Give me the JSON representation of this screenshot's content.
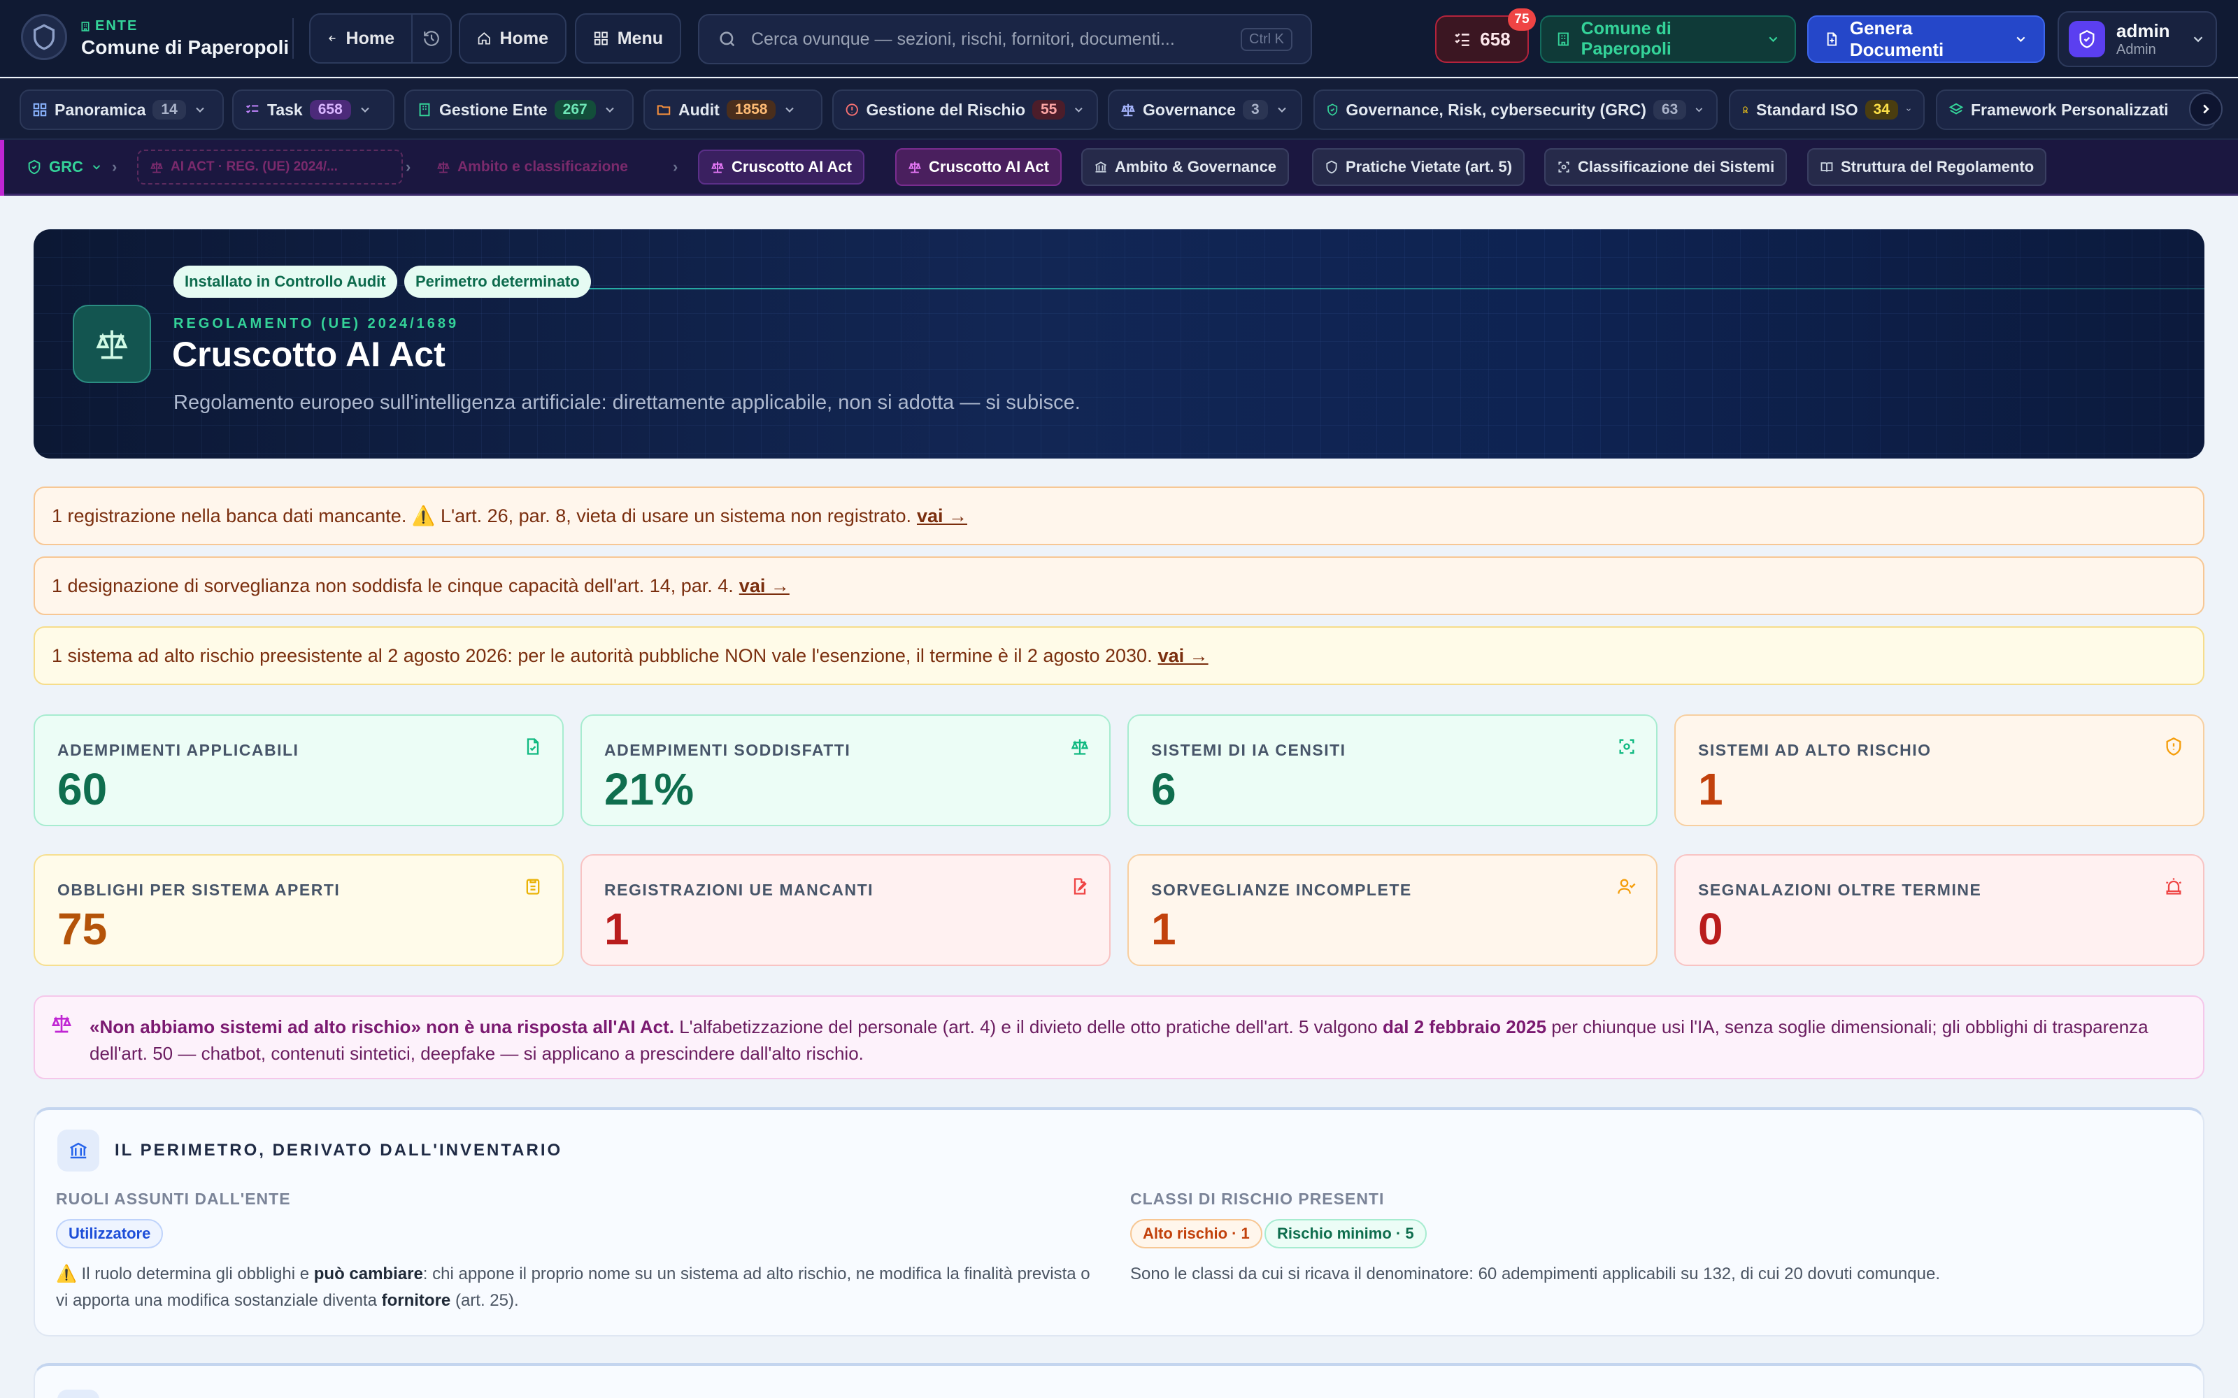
{
  "colors": {
    "accent": "#34d399",
    "brand_blue": "#2547c9",
    "danger": "#ef4444",
    "purple": "#c026d3"
  },
  "header": {
    "ente_label": "ENTE",
    "ente_name": "Comune di Paperopoli",
    "back_home_label": "Home",
    "home_label": "Home",
    "menu_label": "Menu",
    "search_placeholder": "Cerca ovunque — sezioni, rischi, fornitori, documenti...",
    "search_shortcut": "Ctrl K",
    "tasks_count": "658",
    "tasks_badge": "75",
    "ente_selector": "Comune di Paperopoli",
    "generate_label": "Genera Documenti",
    "user_name": "admin",
    "user_role": "Admin"
  },
  "nav": {
    "tabs": [
      {
        "label": "Panoramica",
        "count": "14",
        "icon": "grid-icon"
      },
      {
        "label": "Task",
        "count": "658",
        "icon": "checklist-icon"
      },
      {
        "label": "Gestione Ente",
        "count": "267",
        "icon": "building-icon"
      },
      {
        "label": "Audit",
        "count": "1858",
        "icon": "folder-icon"
      },
      {
        "label": "Gestione del Rischio",
        "count": "55",
        "icon": "alert-circle-icon"
      },
      {
        "label": "Governance",
        "count": "3",
        "icon": "scale-icon"
      },
      {
        "label": "Governance, Risk, cybersecurity (GRC)",
        "count": "63",
        "icon": "shield-check-icon"
      },
      {
        "label": "Standard ISO",
        "count": "34",
        "icon": "award-icon"
      },
      {
        "label": "Framework Personalizzati",
        "count": "",
        "icon": "layers-icon"
      }
    ]
  },
  "breadcrumb": {
    "root": "GRC",
    "level1": "AI ACT · REG. (UE) 2024/...",
    "level2": "Ambito e classificazione",
    "current": "Cruscotto AI Act",
    "subtabs": [
      "Cruscotto AI Act",
      "Ambito & Governance",
      "Pratiche Vietate (art. 5)",
      "Classificazione dei Sistemi",
      "Struttura del Regolamento"
    ]
  },
  "hero": {
    "tags": [
      "Installato in Controllo Audit",
      "Perimetro determinato"
    ],
    "kicker": "REGOLAMENTO (UE) 2024/1689",
    "title": "Cruscotto AI Act",
    "subtitle": "Regolamento europeo sull'intelligenza artificiale: direttamente applicabile, non si adotta — si subisce."
  },
  "alerts": [
    {
      "text": "1 registrazione nella banca dati mancante. ⚠️ L'art. 26, par. 8, vieta di usare un sistema non registrato.",
      "link": "vai →"
    },
    {
      "text": "1 designazione di sorveglianza non soddisfa le cinque capacità dell'art. 14, par. 4.",
      "link": "vai →"
    },
    {
      "text": "1 sistema ad alto rischio preesistente al 2 agosto 2026: per le autorità pubbliche NON vale l'esenzione, il termine è il 2 agosto 2030.",
      "link": "vai →"
    }
  ],
  "kpis": [
    {
      "label": "ADEMPIMENTI APPLICABILI",
      "value": "60",
      "icon": "file-check-icon"
    },
    {
      "label": "ADEMPIMENTI SODDISFATTI",
      "value": "21%",
      "icon": "scale-icon"
    },
    {
      "label": "SISTEMI DI IA CENSITI",
      "value": "6",
      "icon": "scan-icon"
    },
    {
      "label": "SISTEMI AD ALTO RISCHIO",
      "value": "1",
      "icon": "shield-alert-icon"
    },
    {
      "label": "OBBLIGHI PER SISTEMA APERTI",
      "value": "75",
      "icon": "clipboard-icon"
    },
    {
      "label": "REGISTRAZIONI UE MANCANTI",
      "value": "1",
      "icon": "file-edit-icon"
    },
    {
      "label": "SORVEGLIANZE INCOMPLETE",
      "value": "1",
      "icon": "user-check-icon"
    },
    {
      "label": "SEGNALAZIONI OLTRE TERMINE",
      "value": "0",
      "icon": "siren-icon"
    }
  ],
  "note": {
    "bold_lead": "«Non abbiamo sistemi ad alto rischio» non è una risposta all'AI Act.",
    "text_a": " L'alfabetizzazione del personale (art. 4) e il divieto delle otto pratiche dell'art. 5 valgono ",
    "bold_date": "dal 2 febbraio 2025",
    "text_b": " per chiunque usi l'IA, senza soglie dimensionali; gli obblighi di trasparenza dell'art. 50 — chatbot, contenuti sintetici, deepfake — si applicano a prescindere dall'alto rischio."
  },
  "perimeter": {
    "title": "IL PERIMETRO, DERIVATO DALL'INVENTARIO",
    "roles_label": "RUOLI ASSUNTI DALL'ENTE",
    "role_chip": "Utilizzatore",
    "roles_text_a": "⚠️ Il ruolo determina gli obblighi e ",
    "roles_bold_a": "può cambiare",
    "roles_text_b": ": chi appone il proprio nome su un sistema ad alto rischio, ne modifica la finalità prevista o vi apporta una modifica sostanziale diventa ",
    "roles_bold_b": "fornitore",
    "roles_text_c": " (art. 25).",
    "classes_label": "CLASSI DI RISCHIO PRESENTI",
    "class_high": "Alto rischio · 1",
    "class_min": "Rischio minimo · 5",
    "classes_text": "Sono le classi da cui si ricava il denominatore: 60 adempimenti applicabili su 132, di cui 20 dovuti comunque."
  }
}
